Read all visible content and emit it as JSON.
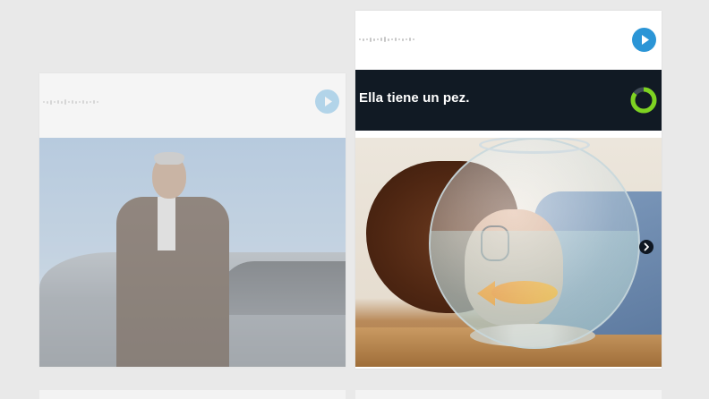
{
  "left_card": {
    "play_icon": "play-icon",
    "image_icon": "photo-man-by-car"
  },
  "right_card": {
    "play_icon": "play-icon",
    "caption": "Ella tiene un pez.",
    "timer_icon": "circular-progress-timer-icon",
    "image_icon": "photo-girl-with-fishbowl"
  },
  "navigation": {
    "next_icon": "chevron-right-icon"
  },
  "colors": {
    "accent": "#2b95d6",
    "caption_bg": "#111a24",
    "timer_green": "#7ed321",
    "page_bg": "#e9e9e9"
  }
}
